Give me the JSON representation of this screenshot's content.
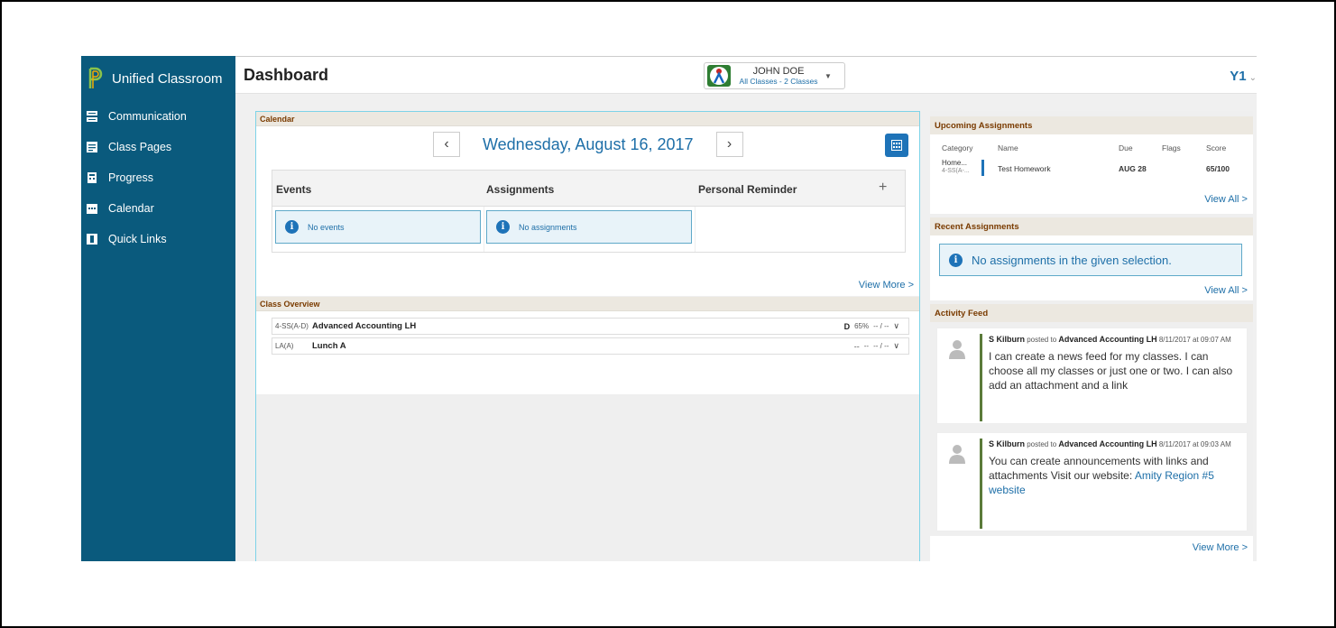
{
  "app": {
    "brand": "Unified Classroom",
    "page_title": "Dashboard"
  },
  "sidebar": {
    "items": [
      {
        "label": "Communication",
        "icon": "communication-icon"
      },
      {
        "label": "Class Pages",
        "icon": "class-pages-icon"
      },
      {
        "label": "Progress",
        "icon": "progress-icon"
      },
      {
        "label": "Calendar",
        "icon": "calendar-icon"
      },
      {
        "label": "Quick Links",
        "icon": "quick-links-icon"
      }
    ]
  },
  "header": {
    "student_name": "JOHN DOE",
    "student_sub": "All Classes - 2 Classes",
    "term": "Y1"
  },
  "calendar": {
    "heading": "Calendar",
    "date": "Wednesday, August 16, 2017",
    "col_events": "Events",
    "col_assignments": "Assignments",
    "col_reminder": "Personal Reminder",
    "no_events": "No events",
    "no_assignments": "No assignments",
    "view_more": "View More >"
  },
  "class_overview": {
    "heading": "Class Overview",
    "rows": [
      {
        "code": "4-SS(A-D)",
        "name": "Advanced Accounting LH",
        "grade": "D",
        "percent": "65%",
        "extra": "-- / --"
      },
      {
        "code": "LA(A)",
        "name": "Lunch A",
        "grade": "--",
        "percent": "--",
        "extra": "-- / --"
      }
    ]
  },
  "upcoming": {
    "heading": "Upcoming Assignments",
    "cols": {
      "category": "Category",
      "name": "Name",
      "due": "Due",
      "flags": "Flags",
      "score": "Score"
    },
    "row": {
      "category_line1": "Home...",
      "category_line2": "4-SS(A-...",
      "name": "Test Homework",
      "due": "AUG 28",
      "score": "65/100"
    },
    "view_all": "View All >"
  },
  "recent": {
    "heading": "Recent Assignments",
    "message": "No assignments in the given selection.",
    "view_all": "View All >"
  },
  "feed": {
    "heading": "Activity Feed",
    "posts": [
      {
        "author": "S Kilburn",
        "posted_to": "posted to",
        "class": "Advanced Accounting LH",
        "time": "8/11/2017 at 09:07 AM",
        "message": "I can create a news feed for my classes. I can choose all my classes or just one or two. I can also add an attachment and a link"
      },
      {
        "author": "S Kilburn",
        "posted_to": "posted to",
        "class": "Advanced Accounting LH",
        "time": "8/11/2017 at 09:03 AM",
        "message": "You can create announcements with links and attachments  Visit our website:",
        "link": "Amity Region #5 website"
      }
    ],
    "view_more": "View More >"
  },
  "colors": {
    "sidebar": "#0a5a7d",
    "accent": "#1e6fa8",
    "panel_head": "#7a3b00"
  }
}
